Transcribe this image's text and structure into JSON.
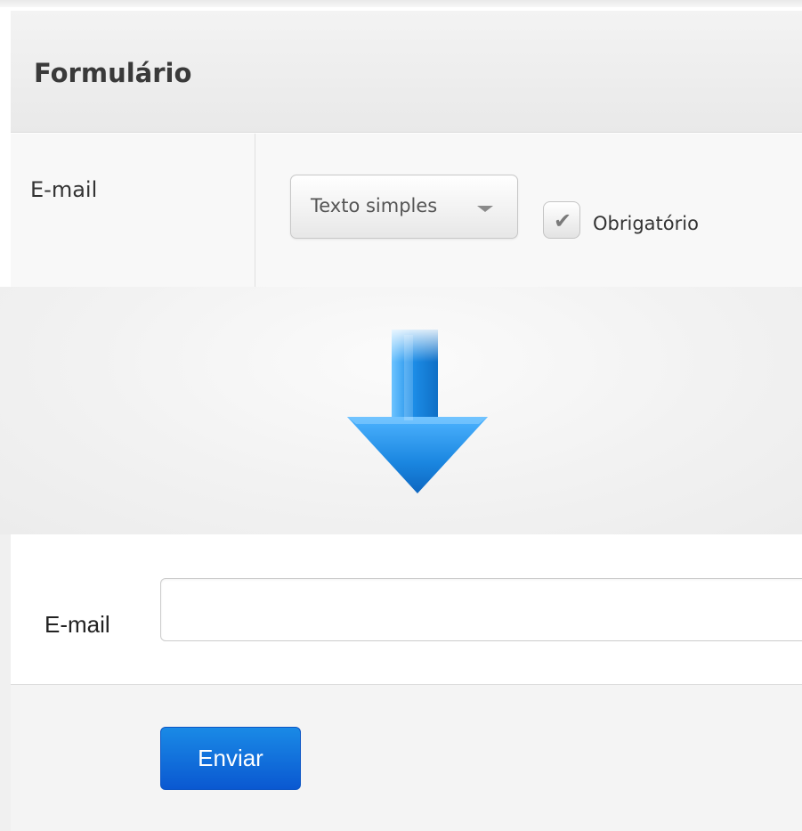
{
  "editor": {
    "section_title": "Formulário",
    "field": {
      "label": "E-mail",
      "type_select_value": "Texto simples",
      "required_label": "Obrigatório",
      "required_checked": true
    }
  },
  "transition_icon": "arrow-down-icon",
  "preview": {
    "field_label": "E-mail",
    "input_value": "",
    "submit_label": "Enviar"
  },
  "colors": {
    "arrow": "#1e86df",
    "submit_button": "#0a63d6"
  }
}
